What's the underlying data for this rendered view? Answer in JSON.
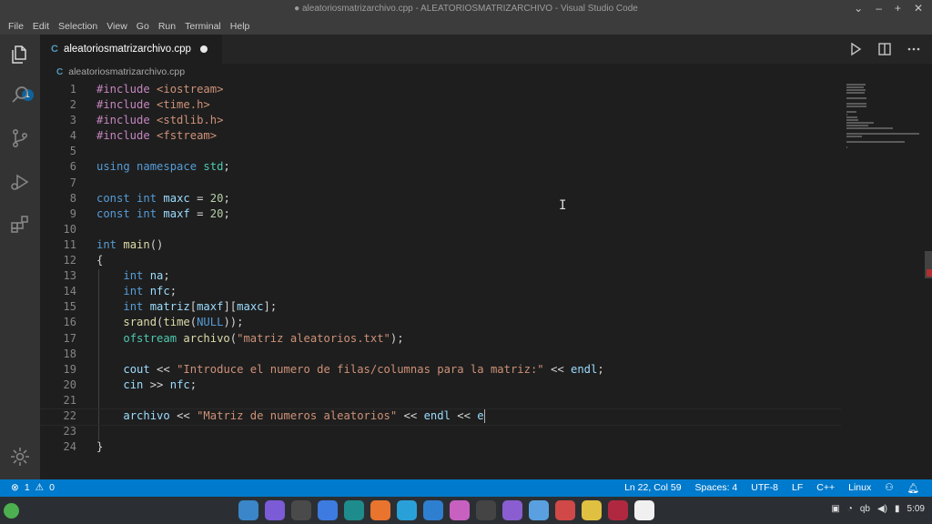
{
  "window": {
    "title": "● aleatoriosmatrizarchivo.cpp - ALEATORIOSMATRIZARCHIVO - Visual Studio Code",
    "controls": [
      "⌄",
      "–",
      "+",
      "✕"
    ]
  },
  "menu": [
    "File",
    "Edit",
    "Selection",
    "View",
    "Go",
    "Run",
    "Terminal",
    "Help"
  ],
  "activity_bar": {
    "icons": [
      "files-icon",
      "search-icon",
      "source-control-icon",
      "run-debug-icon",
      "extensions-icon",
      "settings-gear-icon"
    ],
    "explorer_badge": "1"
  },
  "tab": {
    "label": "aleatoriosmatrizarchivo.cpp",
    "file_icon": "C"
  },
  "breadcrumb": {
    "file_icon": "C",
    "label": "aleatoriosmatrizarchivo.cpp"
  },
  "editor": {
    "line_numbers": [
      "1",
      "2",
      "3",
      "4",
      "5",
      "6",
      "7",
      "8",
      "9",
      "10",
      "11",
      "12",
      "13",
      "14",
      "15",
      "16",
      "17",
      "18",
      "19",
      "20",
      "21",
      "22",
      "23",
      "24"
    ],
    "current_line": 22
  },
  "status": {
    "errors": "1",
    "warnings": "0",
    "position": "Ln 22, Col 59",
    "spaces": "Spaces: 4",
    "encoding": "UTF-8",
    "eol": "LF",
    "language": "C++",
    "platform": "Linux"
  },
  "taskbar": {
    "clock": "5:09",
    "colors": {
      "accent": "#007acc",
      "dock": [
        "#3a86c8",
        "#7b5bd6",
        "#4a4a4a",
        "#3d7be0",
        "#1e8c8c",
        "#e8742e",
        "#2aa0d8",
        "#2f7fd0",
        "#c860c0",
        "#444444",
        "#8a5ed0",
        "#5aa0e0",
        "#d04848",
        "#e0c040",
        "#b02840",
        "#f0f0f0"
      ]
    }
  }
}
